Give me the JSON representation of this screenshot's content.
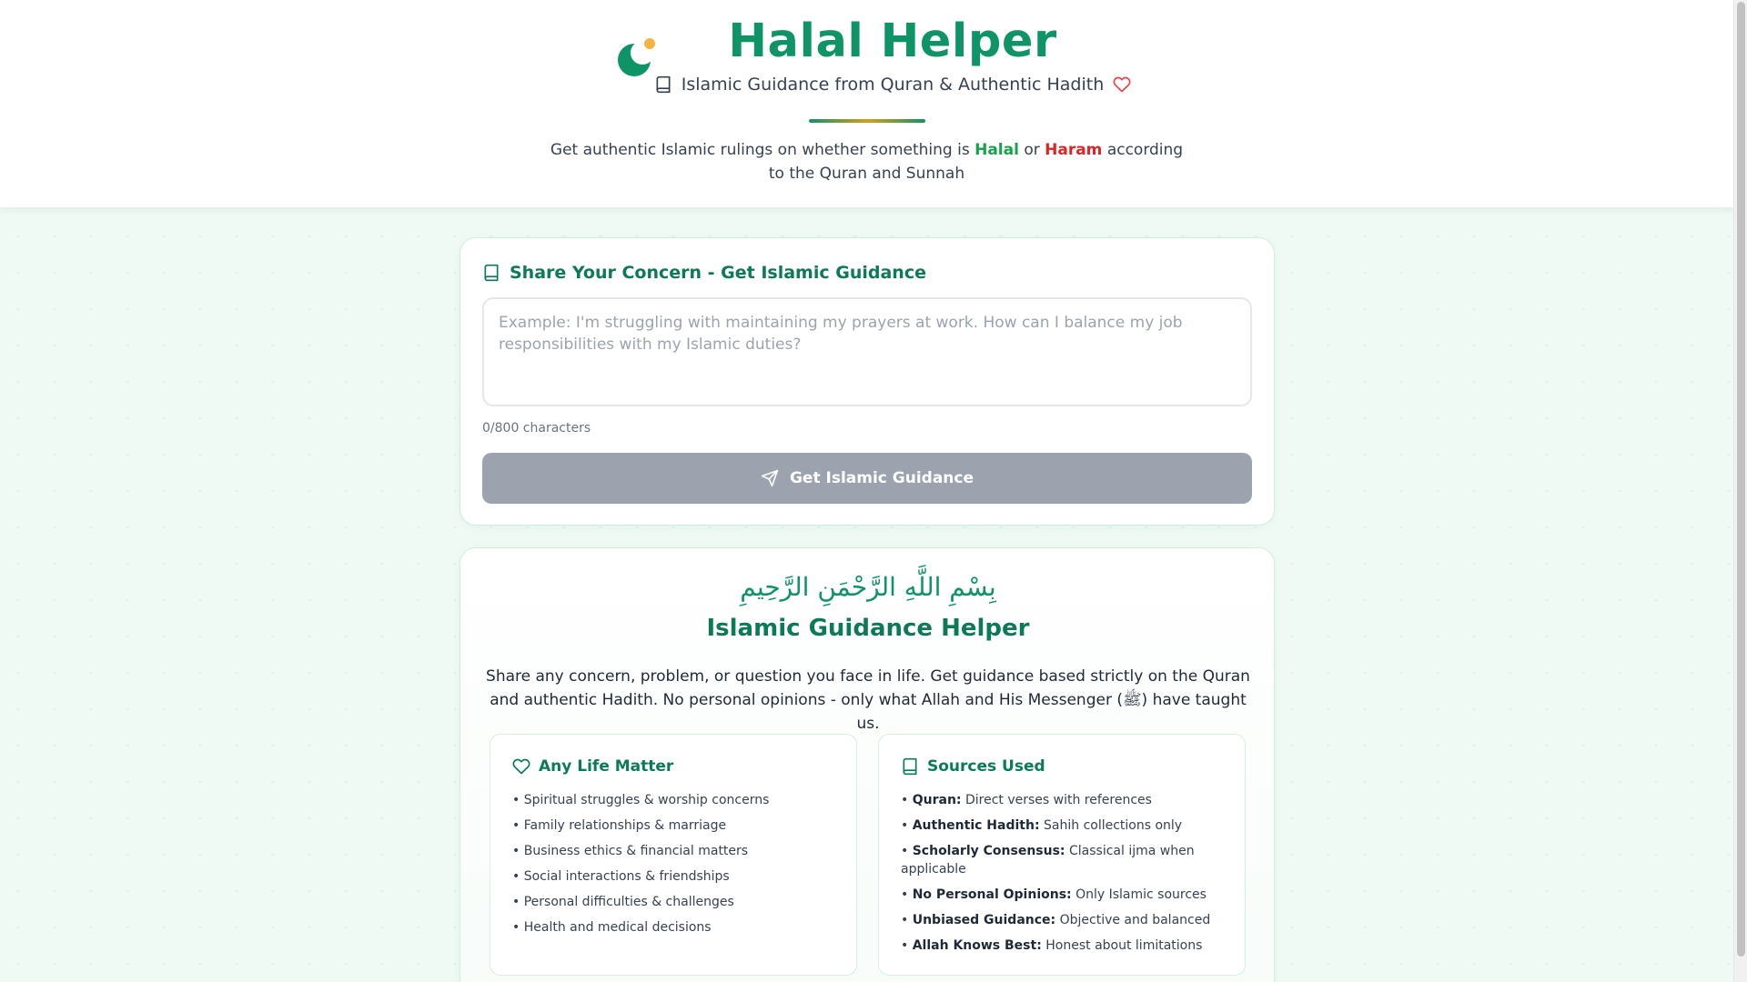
{
  "header": {
    "title": "Halal Helper",
    "tagline": "Islamic Guidance from Quran & Authentic Hadith",
    "intro_before": "Get authentic Islamic rulings on whether something is",
    "halal": "Halal",
    "or": "or",
    "haram": "Haram",
    "intro_after": "according to the Quran and Sunnah"
  },
  "form": {
    "heading": "Share Your Concern - Get Islamic Guidance",
    "placeholder": "Example: I'm struggling with maintaining my prayers at work. How can I balance my job responsibilities with my Islamic duties?",
    "value": "",
    "char_count": "0/800 characters",
    "submit_label": "Get Islamic Guidance"
  },
  "info": {
    "bismillah": "بِسْمِ اللَّهِ الرَّحْمَنِ الرَّحِيمِ",
    "title": "Islamic Guidance Helper",
    "description": "Share any concern, problem, or question you face in life. Get guidance based strictly on the Quran and authentic Hadith. No personal opinions - only what Allah and His Messenger (ﷺ) have taught us.",
    "life_matters": {
      "heading": "Any Life Matter",
      "items": [
        "Spiritual struggles & worship concerns",
        "Family relationships & marriage",
        "Business ethics & financial matters",
        "Social interactions & friendships",
        "Personal difficulties & challenges",
        "Health and medical decisions"
      ]
    },
    "sources": {
      "heading": "Sources Used",
      "items": [
        {
          "label": "Quran:",
          "text": "Direct verses with references"
        },
        {
          "label": "Authentic Hadith:",
          "text": "Sahih collections only"
        },
        {
          "label": "Scholarly Consensus:",
          "text": "Classical ijma when applicable"
        },
        {
          "label": "No Personal Opinions:",
          "text": "Only Islamic sources"
        },
        {
          "label": "Unbiased Guidance:",
          "text": "Objective and balanced"
        },
        {
          "label": "Allah Knows Best:",
          "text": "Honest about limitations"
        }
      ]
    }
  },
  "colors": {
    "brand": "#0e9465",
    "halal": "#16a34a",
    "haram": "#dc2626",
    "gold": "#f2b544"
  },
  "icons": [
    "crescent-logo-icon",
    "book-icon",
    "heart-icon",
    "send-icon"
  ]
}
